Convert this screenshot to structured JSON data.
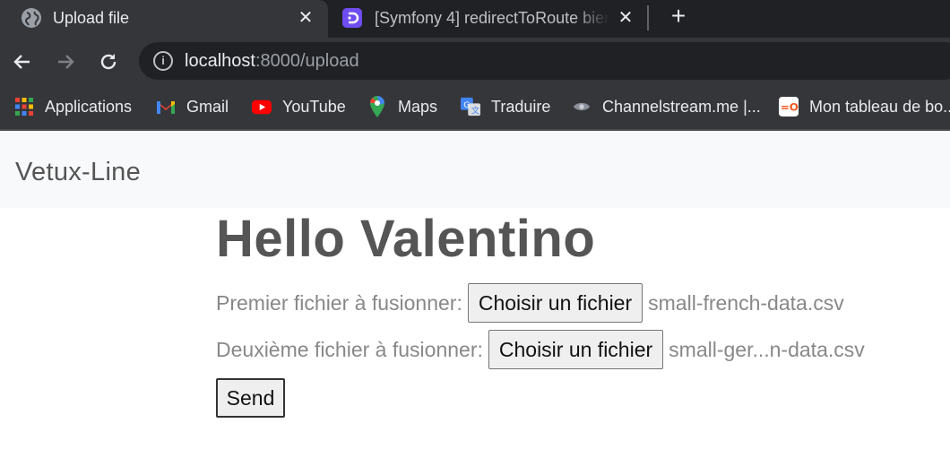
{
  "browser": {
    "tabs": [
      {
        "title": "Upload file",
        "active": true,
        "favicon": "globe-icon"
      },
      {
        "title": "[Symfony 4] redirectToRoute bien",
        "active": false,
        "favicon": "discord-like-icon"
      }
    ],
    "address": {
      "host": "localhost",
      "path": ":8000/upload"
    },
    "bookmarks": [
      {
        "label": "Applications",
        "icon": "apps-grid-icon"
      },
      {
        "label": "Gmail",
        "icon": "gmail-icon"
      },
      {
        "label": "YouTube",
        "icon": "youtube-icon"
      },
      {
        "label": "Maps",
        "icon": "maps-icon"
      },
      {
        "label": "Traduire",
        "icon": "translate-icon"
      },
      {
        "label": "Channelstream.me |...",
        "icon": "channelstream-icon"
      },
      {
        "label": "Mon tableau de bo...",
        "icon": "dashboard-icon"
      }
    ]
  },
  "navbar": {
    "brand": "Vetux-Line"
  },
  "main": {
    "heading": "Hello Valentino",
    "file1": {
      "label": "Premier fichier à fusionner:",
      "button": "Choisir un fichier",
      "filename": "small-french-data.csv"
    },
    "file2": {
      "label": "Deuxième fichier à fusionner:",
      "button": "Choisir un fichier",
      "filename": "small-ger...n-data.csv"
    },
    "submit": "Send"
  }
}
